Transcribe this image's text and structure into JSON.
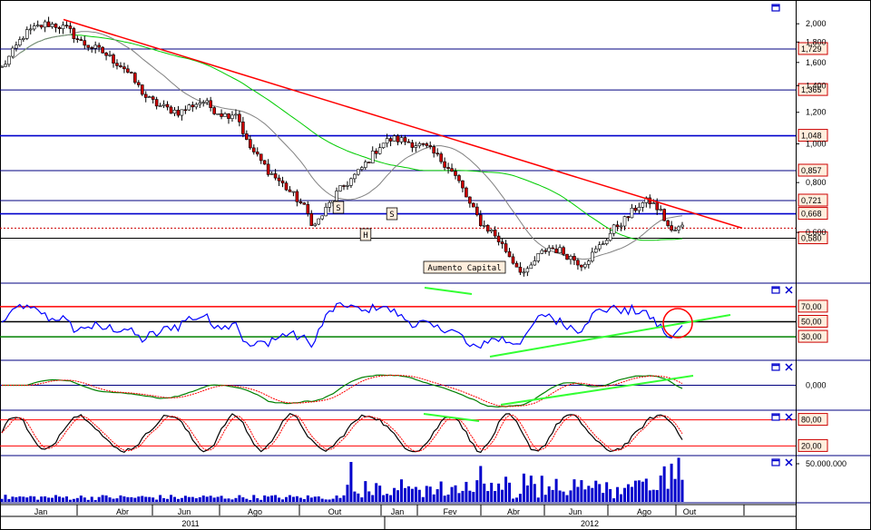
{
  "chart_data": [
    {
      "panel": "price",
      "type": "candlestick",
      "y_scale": "log",
      "ylim": [
        0.45,
        2.2
      ],
      "y_ticks": [
        "2,000",
        "1,800",
        "1,600",
        "1,400",
        "1,200",
        "1,000",
        "0,800",
        "0,600"
      ],
      "levels": [
        {
          "value": 1.729,
          "label": "1,729",
          "color": "#000080"
        },
        {
          "value": 1.365,
          "label": "1,365",
          "color": "#000080"
        },
        {
          "value": 1.048,
          "label": "1,048",
          "color": "#0000cc"
        },
        {
          "value": 0.857,
          "label": "0,857",
          "color": "#000080"
        },
        {
          "value": 0.721,
          "label": "0,721",
          "color": "#000080"
        },
        {
          "value": 0.668,
          "label": "0,668",
          "color": "#0000cc"
        },
        {
          "value": 0.615,
          "label": "",
          "color": "#cc0000",
          "style": "dotted"
        },
        {
          "value": 0.58,
          "label": "0,580",
          "color": "#000000"
        }
      ],
      "current_value_box": "",
      "annotations": [
        "S",
        "S",
        "H",
        "Aumento Capital"
      ],
      "close_series": [
        1.55,
        1.7,
        1.88,
        1.95,
        2.0,
        1.98,
        1.93,
        1.8,
        1.75,
        1.7,
        1.62,
        1.55,
        1.42,
        1.3,
        1.25,
        1.22,
        1.2,
        1.25,
        1.28,
        1.22,
        1.18,
        1.2,
        1.0,
        0.92,
        0.85,
        0.8,
        0.75,
        0.7,
        0.62,
        0.68,
        0.75,
        0.8,
        0.85,
        0.92,
        1.0,
        1.03,
        1.02,
        1.0,
        0.98,
        0.93,
        0.88,
        0.8,
        0.7,
        0.63,
        0.6,
        0.55,
        0.5,
        0.47,
        0.52,
        0.55,
        0.54,
        0.52,
        0.5,
        0.53,
        0.57,
        0.62,
        0.65,
        0.7,
        0.72,
        0.68,
        0.6,
        0.62
      ]
    },
    {
      "panel": "rsi",
      "type": "line",
      "levels": [
        "70,00",
        "50,00",
        "30,00"
      ],
      "level_values": [
        70,
        50,
        30
      ],
      "ylim": [
        0,
        100
      ]
    },
    {
      "panel": "macd",
      "type": "line",
      "levels": [
        "0,000"
      ]
    },
    {
      "panel": "stochastic",
      "type": "line",
      "levels": [
        "80,00",
        "20,00"
      ],
      "level_values": [
        80,
        20
      ],
      "ylim": [
        0,
        100
      ]
    },
    {
      "panel": "volume",
      "type": "bar",
      "levels": [
        "50.000.000"
      ]
    }
  ],
  "x_axis": {
    "months": [
      "Jan",
      "Abr",
      "Jun",
      "Ago",
      "Out",
      "Jan",
      "Fev",
      "Abr",
      "Jun",
      "Ago",
      "Out"
    ],
    "years": [
      "2011",
      "2012"
    ]
  },
  "colors": {
    "trendline": "#ff0000",
    "ma_long": "#00cc00",
    "ma_short": "#808080",
    "rsi": "#0000ff",
    "divergence": "#33ff33",
    "macd_line": "#008000",
    "signal_line": "#ff0000",
    "volume": "#0000cc",
    "label_box_fill": "#ffeedd",
    "label_box_border": "#cc0000"
  },
  "icons": [
    "window-icon",
    "close-x-icon"
  ]
}
